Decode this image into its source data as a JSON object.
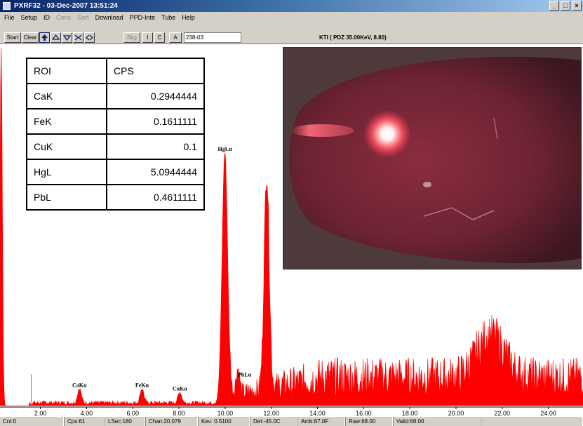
{
  "window": {
    "title": "PXRF32 - 03-Dec-2007 13:51:24",
    "minimize": "_",
    "maximize": "□",
    "close": "×"
  },
  "menu": [
    {
      "label": "File",
      "enabled": true
    },
    {
      "label": "Setup",
      "enabled": true
    },
    {
      "label": "ID",
      "enabled": true
    },
    {
      "label": "Conc",
      "enabled": false
    },
    {
      "label": "Sort",
      "enabled": false
    },
    {
      "label": "Download",
      "enabled": true
    },
    {
      "label": "PPD-Inte",
      "enabled": true
    },
    {
      "label": "Tube",
      "enabled": true
    },
    {
      "label": "Help",
      "enabled": true
    }
  ],
  "toolbar": {
    "start": "Start",
    "clear": "Clear",
    "bkg": "Bkg",
    "i": "I",
    "c": "C",
    "a": "A",
    "sample_id": "238-03",
    "source": "KTI  ( PDZ 35.00KeV, 8.80)"
  },
  "icons": [
    "up-arrow-icon",
    "up-triangle-icon",
    "down-triangle-icon",
    "expand-icon",
    "contract-icon"
  ],
  "roi_table": {
    "headers": [
      "ROI",
      "CPS"
    ],
    "rows": [
      [
        "CaK",
        "0.2944444"
      ],
      [
        "FeK",
        "0.1611111"
      ],
      [
        "CuK",
        "0.1"
      ],
      [
        "HgL",
        "5.0944444"
      ],
      [
        "PbL",
        "0.4611111"
      ]
    ]
  },
  "chart_data": {
    "type": "area",
    "xlabel": "",
    "ylabel": "",
    "xlim": [
      0.25,
      25.5
    ],
    "ylim": [
      0,
      1
    ],
    "x_ticks": [
      "2.00",
      "4.00",
      "6.00",
      "8.00",
      "10.00",
      "12.00",
      "14.00",
      "16.00",
      "18.00",
      "20.00",
      "22.00",
      "24.00"
    ],
    "peak_labels": [
      {
        "text": "CaKα",
        "x": 3.69
      },
      {
        "text": "FeKα",
        "x": 6.4
      },
      {
        "text": "CuKα",
        "x": 8.04
      },
      {
        "text": "HgLα",
        "x": 9.99
      },
      {
        "text": "PbLα",
        "x": 10.55
      }
    ],
    "peaks": [
      {
        "x": 0.3,
        "height": 1.0,
        "width": 0.05
      },
      {
        "x": 9.99,
        "height": 0.7,
        "width": 0.12
      },
      {
        "x": 11.8,
        "height": 0.6,
        "width": 0.11
      },
      {
        "x": 3.69,
        "height": 0.04,
        "width": 0.08
      },
      {
        "x": 6.4,
        "height": 0.04,
        "width": 0.08
      },
      {
        "x": 8.04,
        "height": 0.03,
        "width": 0.08
      },
      {
        "x": 10.55,
        "height": 0.07,
        "width": 0.08
      },
      {
        "x": 21.5,
        "height": 0.12,
        "width": 0.6
      }
    ],
    "colors": {
      "series": "#ff0000"
    }
  },
  "status": [
    "Cnt:0",
    "Cps:61",
    "LSec:180",
    "Chan:20.079",
    "Kev: 0.5100",
    "Det:-45.0C",
    "Amb:87.0F",
    "Raw:68.00",
    "Valid:68.00"
  ]
}
